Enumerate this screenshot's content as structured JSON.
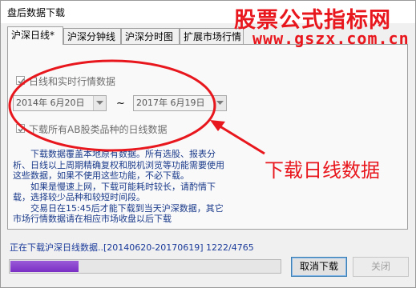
{
  "window": {
    "title": "盘后数据下载"
  },
  "watermark": {
    "text_cn": "股票公式指标网",
    "url": "www.gszx.com.cn"
  },
  "tabs": [
    {
      "label": "沪深日线*"
    },
    {
      "label": "沪深分钟线"
    },
    {
      "label": "沪深分时图"
    },
    {
      "label": "扩展市场行情"
    }
  ],
  "options": {
    "daily_realtime": {
      "label": "日线和实时行情数据",
      "checked": true
    },
    "all_ab": {
      "label": "下载所有AB股类品种的日线数据",
      "checked": true
    }
  },
  "date_range": {
    "start": "2014年 6月20日",
    "separator": "~",
    "end": "2017年 6月19日"
  },
  "info_lines": [
    "下载数据覆盖本地原有数据。所有选股、报表分析、日线以上周期精确复权和脱机浏览等功能需要使用这些数据，如果不使用这些功能，不必下载。",
    "如果是慢速上网，下载可能耗时较长，请酌情下载，选择较少品种和较短时间段。",
    "交易日在15:45后才能下载到当天沪深数据，其它市场行情数据请在相应市场收盘以后下载"
  ],
  "annotation": {
    "text": "下载日线数据"
  },
  "status": {
    "text": "正在下载沪深日线数据..[20140620-20170619]  1222/4765",
    "current": 1222,
    "total": 4765
  },
  "buttons": {
    "cancel_download": "取消下载",
    "close": "关闭"
  },
  "colors": {
    "annotation": "#e8171d",
    "info_text": "#1a3a8a",
    "progress": "#7a2fc4"
  }
}
